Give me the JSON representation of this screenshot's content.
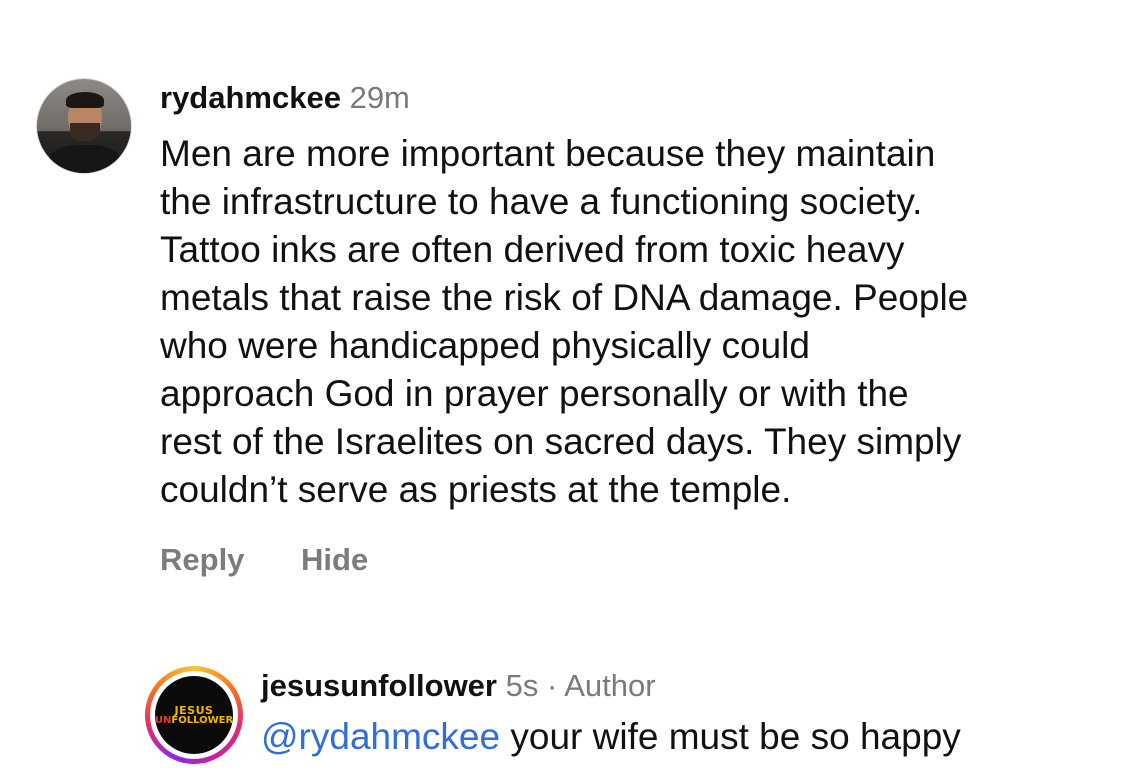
{
  "comments": [
    {
      "username": "rydahmckee",
      "time": "29m",
      "body": "Men are more important because they maintain\nthe infrastructure to have a functioning society.\nTattoo inks are often derived from toxic heavy\nmetals that raise the risk of DNA damage. People\nwho were handicapped physically could\napproach God in prayer personally or with the\nrest of the Israelites on sacred days. They simply\ncouldn’t serve as priests at the temple.",
      "actions": {
        "reply": "Reply",
        "hide": "Hide"
      }
    },
    {
      "username": "jesusunfollower",
      "time": "5s",
      "separator": "·",
      "role": "Author",
      "mention": "@rydahmckee",
      "body": " your wife must be so happy",
      "logo": {
        "top": "JESUS",
        "bottom_un": "UN",
        "bottom_rest": "FOLLOWER"
      }
    }
  ],
  "colors": {
    "text": "#111111",
    "meta": "#7a7a7a",
    "mention": "#2f6fd6",
    "logo_yellow": "#f2b705",
    "logo_red": "#e53935"
  }
}
